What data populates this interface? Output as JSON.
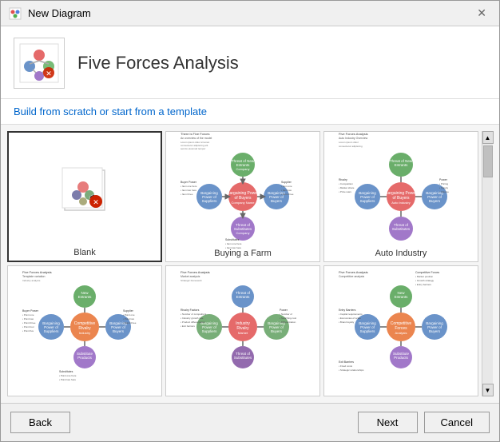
{
  "dialog": {
    "title": "New Diagram",
    "subtitle": "Build from scratch or start from a template",
    "header_title": "Five Forces Analysis"
  },
  "toolbar": {
    "close_label": "✕",
    "back_label": "Back",
    "next_label": "Next",
    "cancel_label": "Cancel"
  },
  "templates": [
    {
      "id": "blank",
      "label": "Blank",
      "selected": true
    },
    {
      "id": "buying-farm",
      "label": "Buying a Farm",
      "selected": false
    },
    {
      "id": "auto-industry",
      "label": "Auto Industry",
      "selected": false
    },
    {
      "id": "template4",
      "label": "",
      "selected": false
    },
    {
      "id": "template5",
      "label": "",
      "selected": false
    },
    {
      "id": "template6",
      "label": "",
      "selected": false
    }
  ]
}
